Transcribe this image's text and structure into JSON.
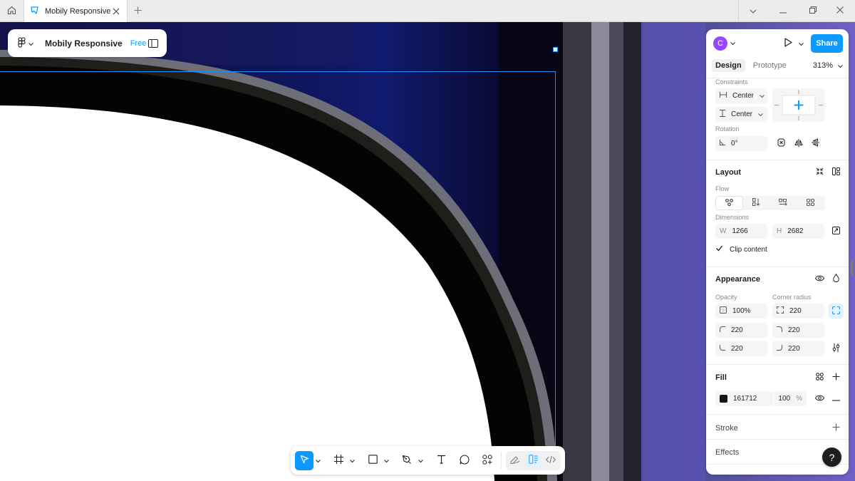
{
  "tab": {
    "title": "Mobily Responsive"
  },
  "file": {
    "title": "Mobily Responsive",
    "plan": "Free"
  },
  "header": {
    "avatar_initial": "C",
    "share_label": "Share"
  },
  "panel_tabs": [
    {
      "label": "Design",
      "active": true
    },
    {
      "label": "Prototype",
      "active": false
    }
  ],
  "zoom": "313%",
  "constraints": {
    "title": "Constraints",
    "horizontal": "Center",
    "vertical": "Center"
  },
  "rotation": {
    "label": "Rotation",
    "value": "0°"
  },
  "layout": {
    "title": "Layout",
    "flow_label": "Flow",
    "dimensions_label": "Dimensions",
    "w_label": "W",
    "w_value": "1266",
    "h_label": "H",
    "h_value": "2682",
    "clip_content_label": "Clip content",
    "clip_content_checked": true
  },
  "appearance": {
    "title": "Appearance",
    "opacity_label": "Opacity",
    "opacity_value": "100%",
    "corner_radius_label": "Corner radius",
    "corner_radius": "220",
    "corners": {
      "top_left": "220",
      "top_right": "220",
      "bottom_left": "220",
      "bottom_right": "220"
    }
  },
  "fill": {
    "title": "Fill",
    "hex": "161712",
    "opacity": "100",
    "percent_sign": "%",
    "swatch_color": "#161712"
  },
  "stroke": {
    "title": "Stroke"
  },
  "effects": {
    "title": "Effects"
  },
  "help": {
    "label": "?"
  },
  "colors": {
    "accent": "#0d99ff",
    "avatar": "#9747ff",
    "selection": "#1e8ff7"
  },
  "icons": [
    "home-icon",
    "figma-logo-icon",
    "close-icon",
    "plus-icon",
    "chevron-down-icon",
    "minimize-icon",
    "maximize-icon",
    "sidebar-toggle-icon",
    "play-icon",
    "move-tool-icon",
    "frame-tool-icon",
    "rectangle-tool-icon",
    "pen-tool-icon",
    "text-tool-icon",
    "comment-tool-icon",
    "actions-icon",
    "draw-mode-icon",
    "design-mode-icon",
    "dev-mode-icon",
    "eye-icon",
    "drop-icon",
    "styles-icon",
    "minus-icon",
    "help-icon"
  ]
}
